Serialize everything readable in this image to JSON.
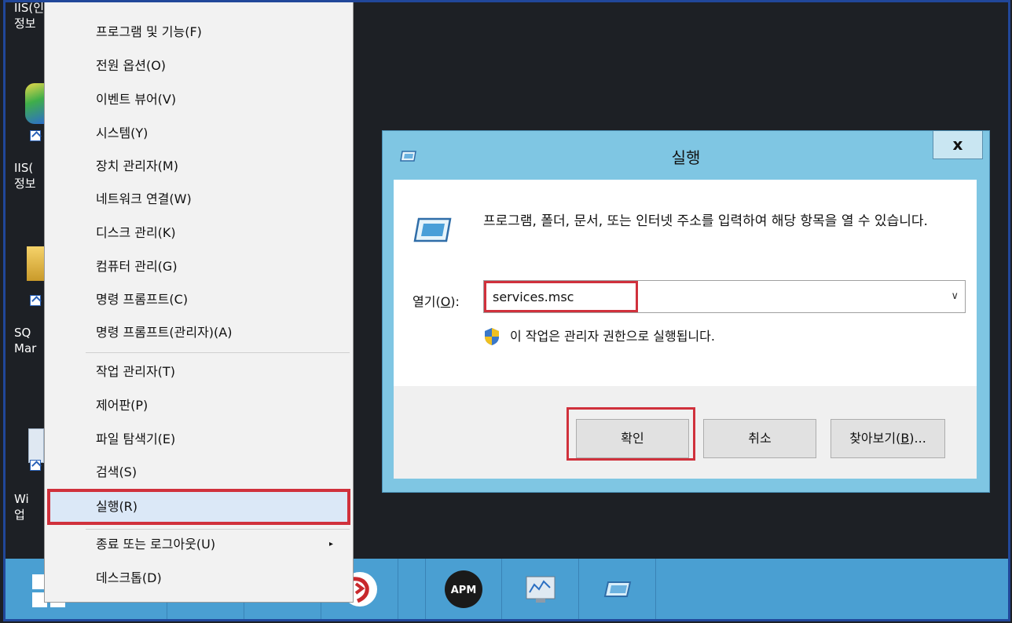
{
  "desktop": {
    "icons": [
      {
        "label_line1": "IIS(인터넷",
        "label_line2": "정보"
      },
      {
        "label_line1": "IIS(",
        "label_line2": "정보"
      },
      {
        "label_line1": "SQ",
        "label_line2": "Mar"
      },
      {
        "label_line1": "Wi",
        "label_line2": "업"
      }
    ]
  },
  "context_menu": {
    "items": [
      {
        "label": "프로그램 및 기능(F)"
      },
      {
        "label": "전원 옵션(O)"
      },
      {
        "label": "이벤트 뷰어(V)"
      },
      {
        "label": "시스템(Y)"
      },
      {
        "label": "장치 관리자(M)"
      },
      {
        "label": "네트워크 연결(W)"
      },
      {
        "label": "디스크 관리(K)"
      },
      {
        "label": "컴퓨터 관리(G)"
      },
      {
        "label": "명령 프롬프트(C)"
      },
      {
        "label": "명령 프롬프트(관리자)(A)"
      },
      {
        "label": "작업 관리자(T)"
      },
      {
        "label": "제어판(P)"
      },
      {
        "label": "파일 탐색기(E)"
      },
      {
        "label": "검색(S)"
      },
      {
        "label": "실행(R)"
      },
      {
        "label": "종료 또는 로그아웃(U)"
      },
      {
        "label": "데스크톱(D)"
      }
    ],
    "submenu_arrow": "▸",
    "highlighted_item": "실행(R)"
  },
  "run_dialog": {
    "title": "실행",
    "close_label": "x",
    "instruction": "프로그램, 폴더, 문서, 또는 인터넷 주소를 입력하여 해당 항목을 열 수 있습니다.",
    "open_label_prefix": "열기(",
    "open_label_key": "O",
    "open_label_suffix": "):",
    "input_value": "services.msc",
    "dropdown_arrow": "∨",
    "admin_note": "이 작업은 관리자 권한으로 실행됩니다.",
    "ok_label": "확인",
    "cancel_label": "취소",
    "browse_prefix": "찾아보기(",
    "browse_key": "B",
    "browse_suffix": ")...",
    "highlight_color": "#d0313c"
  },
  "taskbar": {
    "items": [
      {
        "icon": "start-windows-icon"
      },
      {
        "icon": "server-manager-icon"
      },
      {
        "icon": "powershell-icon"
      },
      {
        "icon": "file-explorer-icon"
      },
      {
        "icon": "pinned-app-red-icon"
      },
      {
        "icon": "apm-icon",
        "text": "APM"
      },
      {
        "icon": "performance-monitor-icon"
      },
      {
        "icon": "run-icon"
      }
    ],
    "color": "#4a9fd2"
  }
}
